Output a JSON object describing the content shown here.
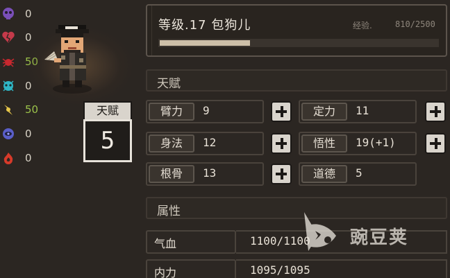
{
  "resistances": [
    {
      "icon": "purple-skull-icon",
      "value": "0",
      "color": "#d8d2c6"
    },
    {
      "icon": "broken-heart-icon",
      "value": "0",
      "color": "#d8d2c6"
    },
    {
      "icon": "red-spider-icon",
      "value": "50",
      "color": "#9bc24a"
    },
    {
      "icon": "cyan-ice-icon",
      "value": "0",
      "color": "#d8d2c6"
    },
    {
      "icon": "yellow-lightning-icon",
      "value": "50",
      "color": "#9bc24a"
    },
    {
      "icon": "blue-eye-icon",
      "value": "0",
      "color": "#d8d2c6"
    },
    {
      "icon": "red-fire-icon",
      "value": "0",
      "color": "#d8d2c6"
    }
  ],
  "character": {
    "title": "等级.17 包狗儿",
    "exp_label": "经验.",
    "exp_value": "810/2500",
    "exp_fraction": 0.324
  },
  "talent": {
    "label": "天赋",
    "points": "5"
  },
  "sections": {
    "talent_header": "天赋",
    "attribute_header": "属性"
  },
  "stats": [
    {
      "label": "臂力",
      "value": "9"
    },
    {
      "label": "定力",
      "value": "11"
    },
    {
      "label": "身法",
      "value": "12"
    },
    {
      "label": "悟性",
      "value": "19(+1)"
    },
    {
      "label": "根骨",
      "value": "13"
    },
    {
      "label": "道德",
      "value": "5"
    }
  ],
  "attributes": [
    {
      "label": "气血",
      "value": "1100/1100"
    },
    {
      "label": "内力",
      "value": "1095/1095"
    }
  ],
  "watermark": {
    "text": "豌豆荚"
  },
  "colors": {
    "background": "#2b2622",
    "accent_green": "#9bc24a",
    "panel_border": "#5c544c",
    "button_face": "#d9d4cc"
  }
}
